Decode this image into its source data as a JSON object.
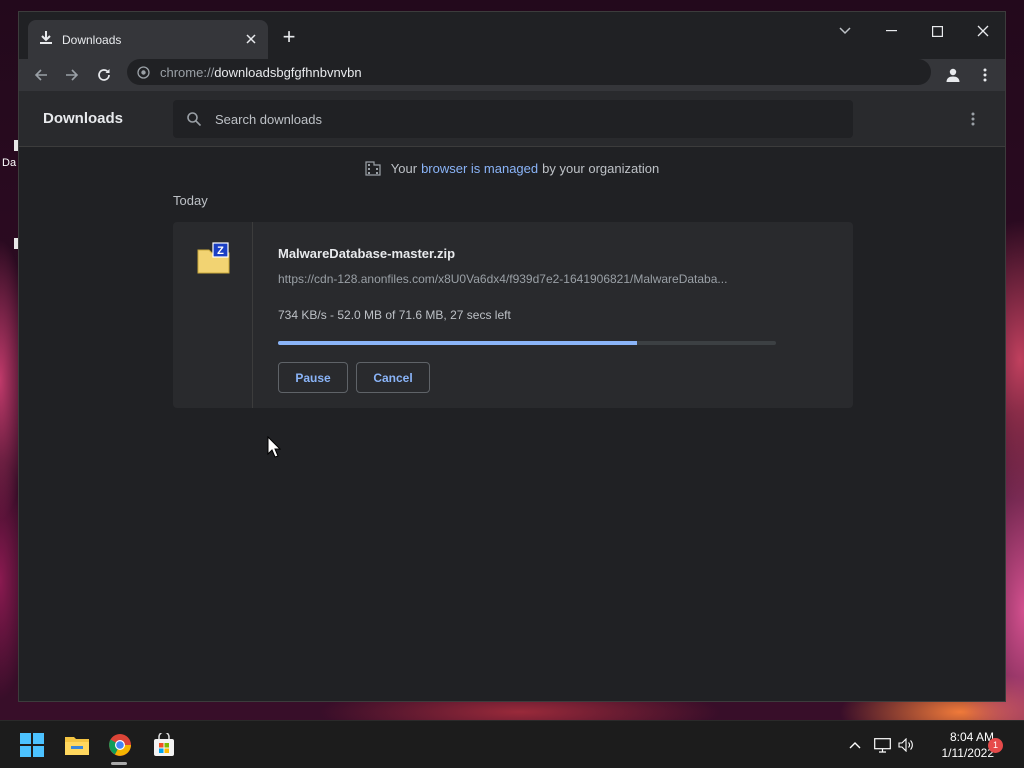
{
  "desktop": {
    "icon_label": "Da"
  },
  "browser": {
    "tab": {
      "title": "Downloads",
      "icon": "download-icon",
      "close_icon": "close-icon"
    },
    "new_tab_label": "+",
    "window_controls": [
      "chevron-down-icon",
      "minimize-icon",
      "maximize-icon",
      "close-icon"
    ],
    "address": {
      "scheme": "chrome://",
      "rest": "downloadsbgfgfhnbvnvbn"
    }
  },
  "downloads_page": {
    "title": "Downloads",
    "search_placeholder": "Search downloads",
    "managed_notice": {
      "prefix": "Your",
      "link": "browser is managed",
      "suffix": "by your organization"
    },
    "day_label": "Today",
    "item": {
      "file_name": "MalwareDatabase-master.zip",
      "url": "https://cdn-128.anonfiles.com/x8U0Va6dx4/f939d7e2-1641906821/MalwareDataba...",
      "status": "734 KB/s - 52.0 MB of 71.6 MB, 27 secs left",
      "progress_percent": 72,
      "pause_label": "Pause",
      "cancel_label": "Cancel"
    }
  },
  "taskbar": {
    "apps": [
      "windows-start-icon",
      "file-explorer-icon",
      "chrome-icon",
      "store-icon"
    ],
    "clock": {
      "time": "8:04 AM",
      "date": "1/11/2022"
    },
    "notification_count": "1"
  },
  "colors": {
    "accent": "#8ab4f8",
    "page_bg": "#202124",
    "card_bg": "#292a2d"
  }
}
